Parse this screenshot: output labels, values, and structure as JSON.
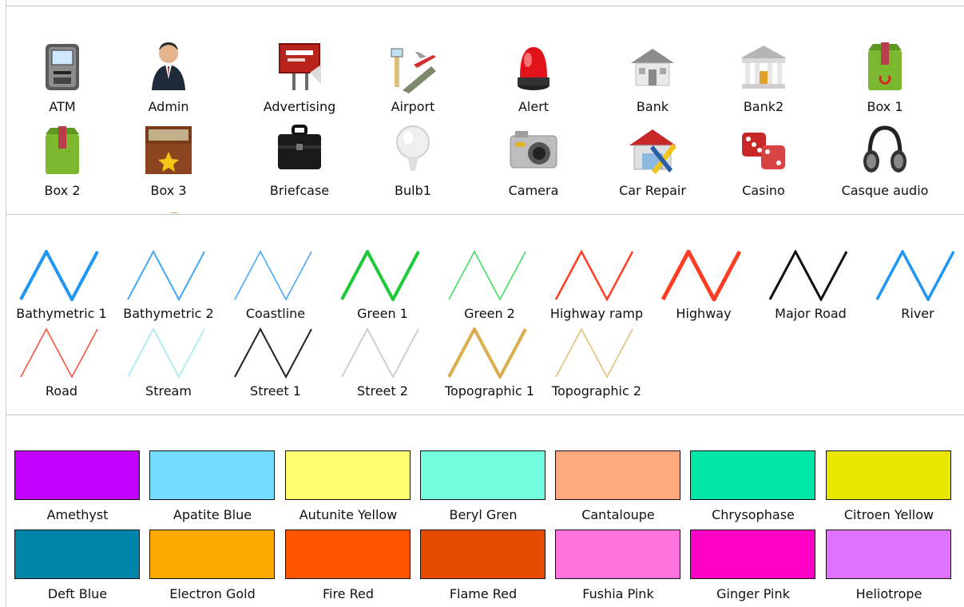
{
  "icons": [
    {
      "label": "ATM",
      "icon": "atm-icon"
    },
    {
      "label": "Admin",
      "icon": "admin-icon"
    },
    {
      "label": "Advertising",
      "icon": "advertising-icon"
    },
    {
      "label": "Airport",
      "icon": "airport-icon"
    },
    {
      "label": "Alert",
      "icon": "alert-icon"
    },
    {
      "label": "Bank",
      "icon": "bank-icon"
    },
    {
      "label": "Bank2",
      "icon": "bank2-icon"
    },
    {
      "label": "Box 1",
      "icon": "box1-icon"
    },
    {
      "label": "Box 2",
      "icon": "box2-icon"
    },
    {
      "label": "Box 3",
      "icon": "box3-icon"
    },
    {
      "label": "Briefcase",
      "icon": "briefcase-icon"
    },
    {
      "label": "Bulb1",
      "icon": "bulb-icon"
    },
    {
      "label": "Camera",
      "icon": "camera-icon"
    },
    {
      "label": "Car Repair",
      "icon": "car-repair-icon"
    },
    {
      "label": "Casino",
      "icon": "casino-icon"
    },
    {
      "label": "Casque audio",
      "icon": "headphones-icon"
    }
  ],
  "line_styles": [
    {
      "label": "Bathymetric 1",
      "color": "#2196f3",
      "width": 4
    },
    {
      "label": "Bathymetric 2",
      "color": "#42a5f5",
      "width": 2
    },
    {
      "label": "Coastline",
      "color": "#42a5f5",
      "width": 1.5
    },
    {
      "label": "Green 1",
      "color": "#1ec93a",
      "width": 4
    },
    {
      "label": "Green 2",
      "color": "#3ddc5a",
      "width": 1.5
    },
    {
      "label": "Highway ramp",
      "color": "#ff3d22",
      "width": 2.5
    },
    {
      "label": "Highway",
      "color": "#ff3d22",
      "width": 5
    },
    {
      "label": "Major Road",
      "color": "#111111",
      "width": 3
    },
    {
      "label": "River",
      "color": "#2196f3",
      "width": 3.5
    },
    {
      "label": "Road",
      "color": "#ff4a33",
      "width": 1.5
    },
    {
      "label": "Stream",
      "color": "#b3ecf5",
      "width": 2
    },
    {
      "label": "Street 1",
      "color": "#222222",
      "width": 2
    },
    {
      "label": "Street 2",
      "color": "#cfcfcf",
      "width": 2
    },
    {
      "label": "Topographic 1",
      "color": "#dcad4e",
      "width": 4
    },
    {
      "label": "Topographic 2",
      "color": "#e2bd72",
      "width": 1.5
    }
  ],
  "colors": [
    {
      "label": "Amethyst",
      "hex": "#c300ff"
    },
    {
      "label": "Apatite Blue",
      "hex": "#73dcff"
    },
    {
      "label": "Autunite Yellow",
      "hex": "#ffff73"
    },
    {
      "label": "Beryl Gren",
      "hex": "#73ffdf"
    },
    {
      "label": "Cantaloupe",
      "hex": "#ffa77f"
    },
    {
      "label": "Chrysophase",
      "hex": "#00e6a9"
    },
    {
      "label": "Citroen Yellow",
      "hex": "#e6e600"
    },
    {
      "label": "Deft Blue",
      "hex": "#0084a8"
    },
    {
      "label": "Electron Gold",
      "hex": "#ffaa00"
    },
    {
      "label": "Fire Red",
      "hex": "#ff5500"
    },
    {
      "label": "Flame Red",
      "hex": "#e64c00"
    },
    {
      "label": "Fushia Pink",
      "hex": "#ff73df"
    },
    {
      "label": "Ginger Pink",
      "hex": "#ff00c5"
    },
    {
      "label": "Heliotrope",
      "hex": "#df73ff"
    }
  ]
}
